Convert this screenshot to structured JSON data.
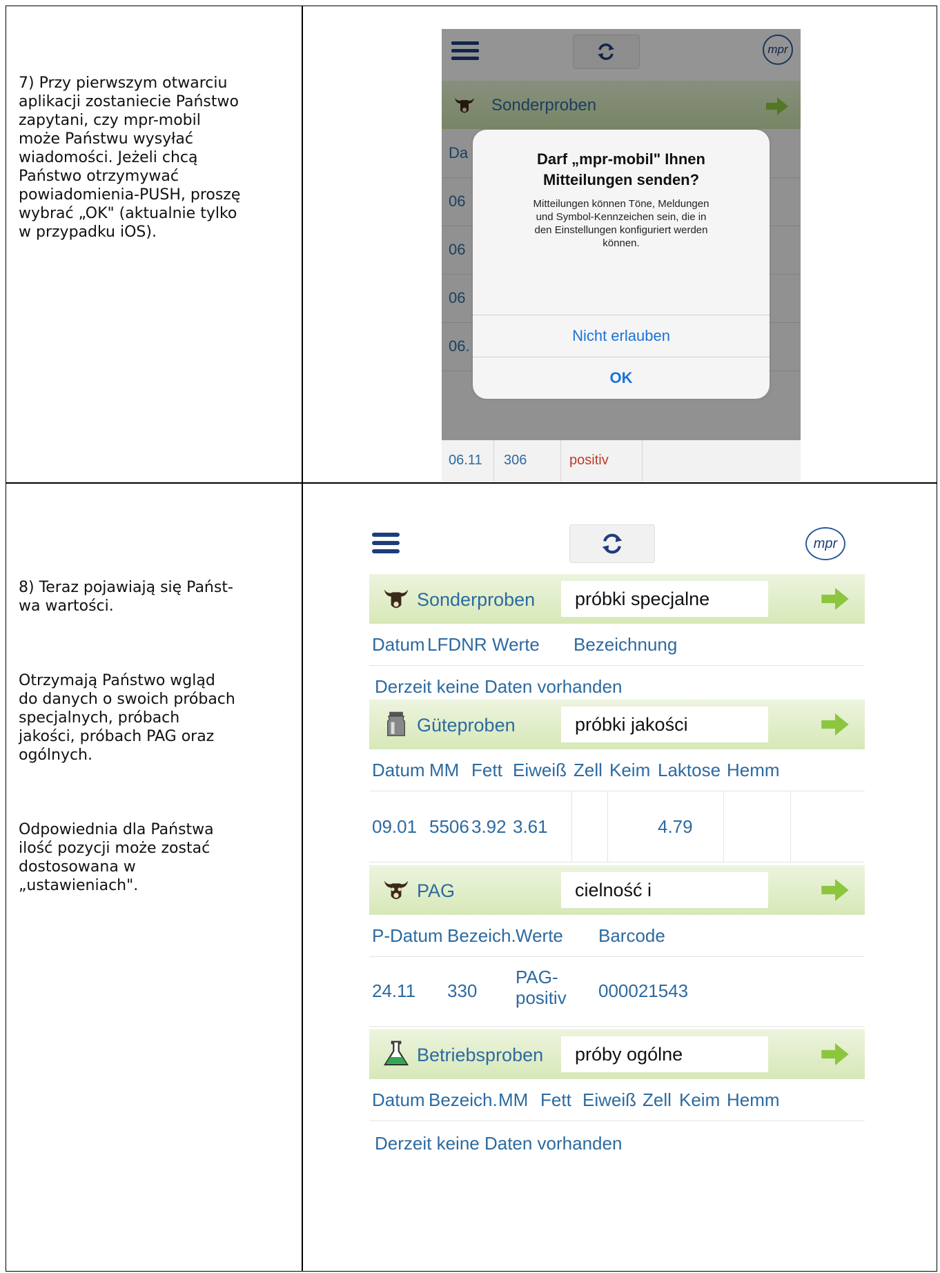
{
  "step7": {
    "text": "7) Przy pierwszym otwarciu\naplikacji zostaniecie Państwo\nzapytani, czy mpr-mobil\nmoże Państwu wysyłać\nwiadomości. Jeżeli chcą\nPaństwo otrzymywać\npowiadomienia-PUSH, proszę\nwybrać „OK\" (aktualnie tylko\nw przypadku iOS)."
  },
  "step8": {
    "p1": "8) Teraz pojawiają się Państ-\nwa wartości.",
    "p2": "Otrzymają Państwo wgląd\ndo danych o swoich próbach\nspecjalnych, próbach\njakości, próbach PAG oraz\nogólnych.",
    "p3": "Odpowiednia dla Państwa\nilość pozycji może zostać\ndostosowana w\n„ustawieniach\"."
  },
  "shot1": {
    "section_label": "Sonderproben",
    "row_prefixes": [
      "Da",
      "06",
      "06",
      "06",
      "06."
    ],
    "alert": {
      "title": "Darf „mpr-mobil\" Ihnen\nMitteilungen senden?",
      "message": "Mitteilungen können Töne, Meldungen\nund Symbol-Kennzeichen sein, die in\nden Einstellungen konfiguriert werden\nkönnen.",
      "deny": "Nicht erlauben",
      "ok": "OK"
    },
    "bottom_row": {
      "date": "06.11",
      "nr": "306",
      "value": "positiv"
    }
  },
  "shot2": {
    "sonder": {
      "label": "Sonderproben",
      "overlay": "próbki specjalne",
      "headers": [
        "Datum",
        "LFDNR",
        "Werte",
        "Bezeichnung"
      ],
      "nodata": "Derzeit keine Daten vorhanden"
    },
    "gute": {
      "label": "Güteproben",
      "overlay": "próbki jakości",
      "headers": [
        "Datum",
        "MM",
        "Fett",
        "Eiweiß",
        "Zell",
        "Keim",
        "Laktose",
        "Hemm"
      ],
      "row": [
        "09.01",
        "5506",
        "3.92",
        "3.61",
        "",
        "",
        "4.79",
        ""
      ]
    },
    "pag": {
      "label": "PAG",
      "overlay": "cielność i",
      "headers": [
        "P-Datum",
        "Bezeich.",
        "Werte",
        "Barcode"
      ],
      "row": [
        "24.11",
        "330",
        "PAG-\npositiv",
        "000021543"
      ]
    },
    "betrieb": {
      "label": "Betriebsproben",
      "overlay": "próby  ogólne",
      "headers": [
        "Datum",
        "Bezeich.",
        "MM",
        "Fett",
        "Eiweiß",
        "Zell",
        "Keim",
        "Hemm"
      ],
      "nodata": "Derzeit keine Daten vorhanden"
    },
    "logo_text": "mpr"
  },
  "colors": {
    "link_blue": "#2c6aa0",
    "menu_navy": "#1e3d7a",
    "green_arrow": "#8cc63f",
    "ios_blue": "#1a73d8"
  }
}
